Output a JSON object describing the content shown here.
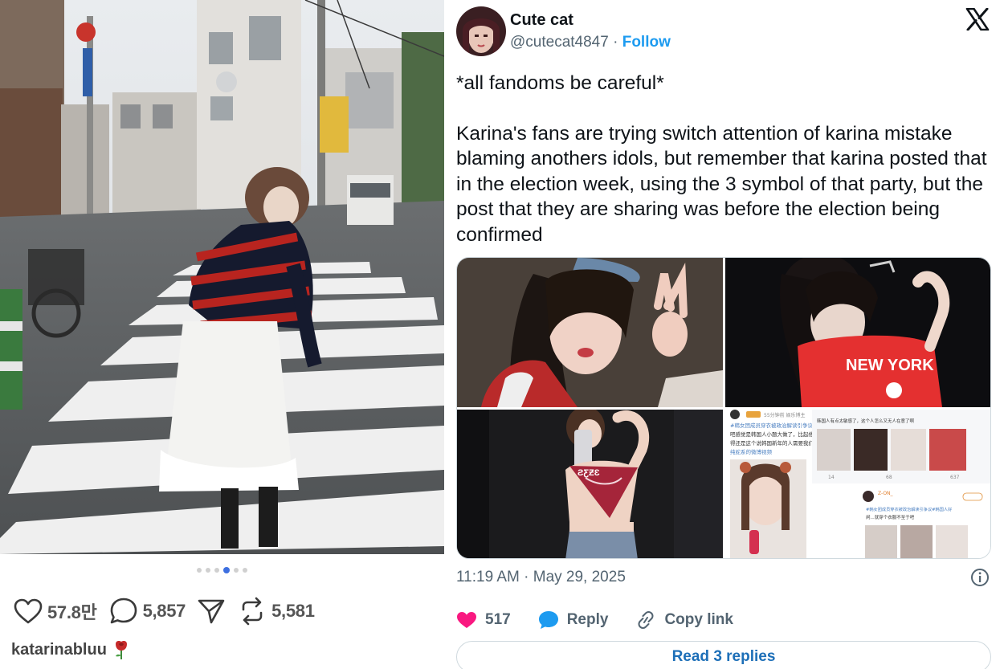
{
  "instagram_post": {
    "carousel": {
      "total": 6,
      "active_index": 3
    },
    "actions": {
      "likes": "57.8만",
      "comments": "5,857",
      "reposts": "5,581"
    },
    "username": "katarinabluu",
    "icons": [
      "heart-icon",
      "comment-bubble-icon",
      "send-icon",
      "repost-icon",
      "rose-emoji-icon"
    ]
  },
  "tweet": {
    "author": {
      "display_name": "Cute cat",
      "handle": "@cutecat4847",
      "separator": " · ",
      "follow_label": "Follow"
    },
    "text_paragraphs": [
      "*all fandoms be careful*",
      "Karina's fans are trying switch attention of karina mistake blaming anothers idols, but remember that karina posted that in the election week, using the 3 symbol of that party, but the post that they are sharing was before the election being confirmed"
    ],
    "media": [
      {
        "name": "photo-selfie-peace-sign"
      },
      {
        "name": "photo-flash-new-york-shirt"
      },
      {
        "name": "photo-mirror-selfie-bandana"
      },
      {
        "name": "screenshot-weibo-posts",
        "snippets": {
          "meta_line": "55分钟前 娱乐博主",
          "hashtag_line": "#韩女团成员穿衣被政治解读引争议#真的",
          "body_line_1": "吧感觉是韩国人小题大做了，比起他国的",
          "body_line_2": "得还是这个说韩国新年的人需要我们共同",
          "link_line": "纯蛇系的微博视频",
          "right_top": "韩国人有点太敏感了，这个人怎么又无人在意了啊",
          "stat_1": "14",
          "stat_2": "68",
          "stat_3": "637",
          "commenter": "Z-ON_",
          "comment_hashtag": "#韩女团成员穿衣被政治解读引争议#韩国人好",
          "comment_body": "闲...就穿个衣服不至于吧"
        }
      }
    ],
    "timestamp": "11:19 AM · May 29, 2025",
    "engagement": {
      "likes": "517",
      "reply_label": "Reply",
      "copy_link_label": "Copy link"
    },
    "read_replies_label": "Read 3 replies",
    "colors": {
      "accent": "#1d9bf0",
      "like_pink": "#f91880",
      "text_secondary": "#536471"
    }
  }
}
